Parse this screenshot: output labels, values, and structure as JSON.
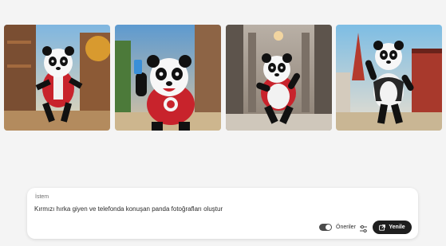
{
  "gallery": {
    "images": [
      {
        "name": "panda-image-1"
      },
      {
        "name": "panda-image-2"
      },
      {
        "name": "panda-image-3"
      },
      {
        "name": "panda-image-4"
      }
    ]
  },
  "prompt": {
    "label": "İstem",
    "value": "Kırmızı hırka giyen ve telefonda konuşan panda fotoğrafları oluştur"
  },
  "controls": {
    "suggestions_label": "Öneriler",
    "suggestions_enabled": true,
    "settings_icon": "settings-sliders-icon",
    "refresh_label": "Yenile",
    "refresh_icon": "refresh-icon"
  },
  "colors": {
    "background": "#f4f4f4",
    "panel": "#ffffff",
    "button": "#1e1e1e",
    "accent_red": "#c8232c"
  }
}
